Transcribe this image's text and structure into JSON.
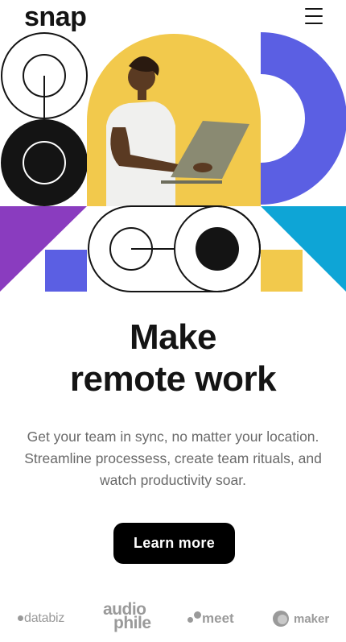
{
  "brand": {
    "logo": "snap"
  },
  "header": {
    "menu_icon": "hamburger-menu-icon"
  },
  "hero": {
    "illustration_icon": "person-with-laptop-illustration",
    "title_lines": [
      "Make",
      "remote work"
    ],
    "description_lines": [
      "Get your team in sync, no matter your location.",
      "Streamline processess, create team rituals, and",
      "watch productivity soar."
    ],
    "cta_label": "Learn more"
  },
  "clients": {
    "databiz": "databiz",
    "audiophile_lines": [
      "audio",
      "phile"
    ],
    "meet": "meet",
    "maker": "maker"
  },
  "colors": {
    "text": "#141414",
    "muted": "#696969",
    "yellow": "#f2c94c",
    "blue": "#5b5fe3",
    "purple": "#8a3cbf",
    "cyan": "#0ea5d6",
    "black": "#141414"
  }
}
